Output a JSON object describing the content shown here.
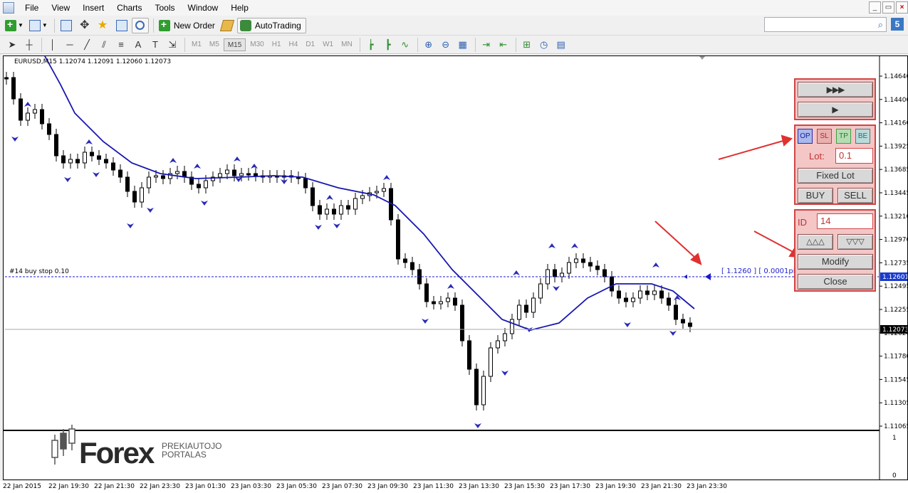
{
  "menu": [
    "File",
    "View",
    "Insert",
    "Charts",
    "Tools",
    "Window",
    "Help"
  ],
  "window_controls": [
    "_",
    "▭",
    "×"
  ],
  "toolbar1": {
    "new_order": "New Order",
    "autotrading": "AutoTrading",
    "notify_count": "5"
  },
  "timeframes": [
    "M1",
    "M5",
    "M15",
    "M30",
    "H1",
    "H4",
    "D1",
    "W1",
    "MN"
  ],
  "active_timeframe": "M15",
  "chart": {
    "header": "EURUSD,M15  1.12074 1.12091 1.12060 1.12073",
    "order_label": "#14 buy stop 0.10",
    "order_info": "[ 1.1260 ] [ 0.0001pips=1.00 $ ]",
    "order_price": "1.12601",
    "current_price": "1.12073",
    "price_ticks": [
      "1.14640",
      "1.14400",
      "1.14160",
      "1.13925",
      "1.13685",
      "1.13445",
      "1.13210",
      "1.12970",
      "1.12735",
      "1.12495",
      "1.12255",
      "1.12020",
      "1.11780",
      "1.11545",
      "1.11305",
      "1.11065"
    ],
    "sub_ticks": [
      "1",
      "0"
    ],
    "dates": [
      "22 Jan 2015",
      "22 Jan 19:30",
      "22 Jan 21:30",
      "22 Jan 23:30",
      "23 Jan 01:30",
      "23 Jan 03:30",
      "23 Jan 05:30",
      "23 Jan 07:30",
      "23 Jan 09:30",
      "23 Jan 11:30",
      "23 Jan 13:30",
      "23 Jan 15:30",
      "23 Jan 17:30",
      "23 Jan 19:30",
      "23 Jan 21:30",
      "23 Jan 23:30"
    ]
  },
  "panel": {
    "fast_forward": "▶▶▶",
    "play": "▶",
    "op": "OP",
    "sl": "SL",
    "tp": "TP",
    "be": "BE",
    "lot_label": "Lot:",
    "lot_value": "0.1",
    "fixed_lot": "Fixed Lot",
    "buy": "BUY",
    "sell": "SELL",
    "id_label": "ID",
    "id_value": "14",
    "up_triangles": "△△△",
    "down_triangles": "▽▽▽",
    "modify": "Modify",
    "close": "Close"
  },
  "logo": {
    "brand": "Forex",
    "line1": "PREKIAUTOJO",
    "line2": "PORTALAS"
  },
  "colors": {
    "panel_border": "#d04545",
    "panel_bg": "#f4c6c6",
    "ma_line": "#1717b0",
    "arrow": "#e03030",
    "price_tag": "#1a3ccc"
  }
}
